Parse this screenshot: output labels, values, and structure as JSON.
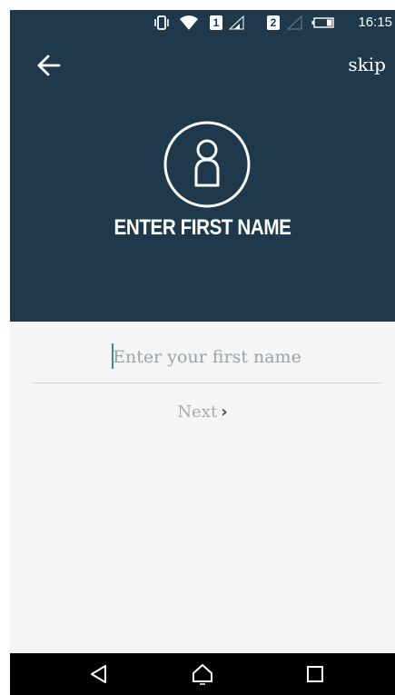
{
  "status_bar": {
    "time": "16:15",
    "sim1": "1",
    "sim2": "2",
    "icons": [
      "vibrate-icon",
      "wifi-icon",
      "signal-icon",
      "signal-empty-icon",
      "battery-icon"
    ]
  },
  "header": {
    "back_icon": "arrow-left-icon",
    "skip_label": "skip",
    "avatar_icon": "user-avatar-icon",
    "title": "ENTER FIRST NAME"
  },
  "form": {
    "first_name_value": "",
    "first_name_placeholder": "Enter your first name",
    "next_label": "Next",
    "next_icon": "chevron-right-icon"
  },
  "nav_bar": {
    "icons": [
      "back-triangle-icon",
      "home-icon",
      "recents-icon"
    ]
  },
  "colors": {
    "header_bg": "#1e394b",
    "body_bg": "#f5f5f5",
    "caret": "#2f8fa3",
    "navbar_bg": "#000000"
  }
}
